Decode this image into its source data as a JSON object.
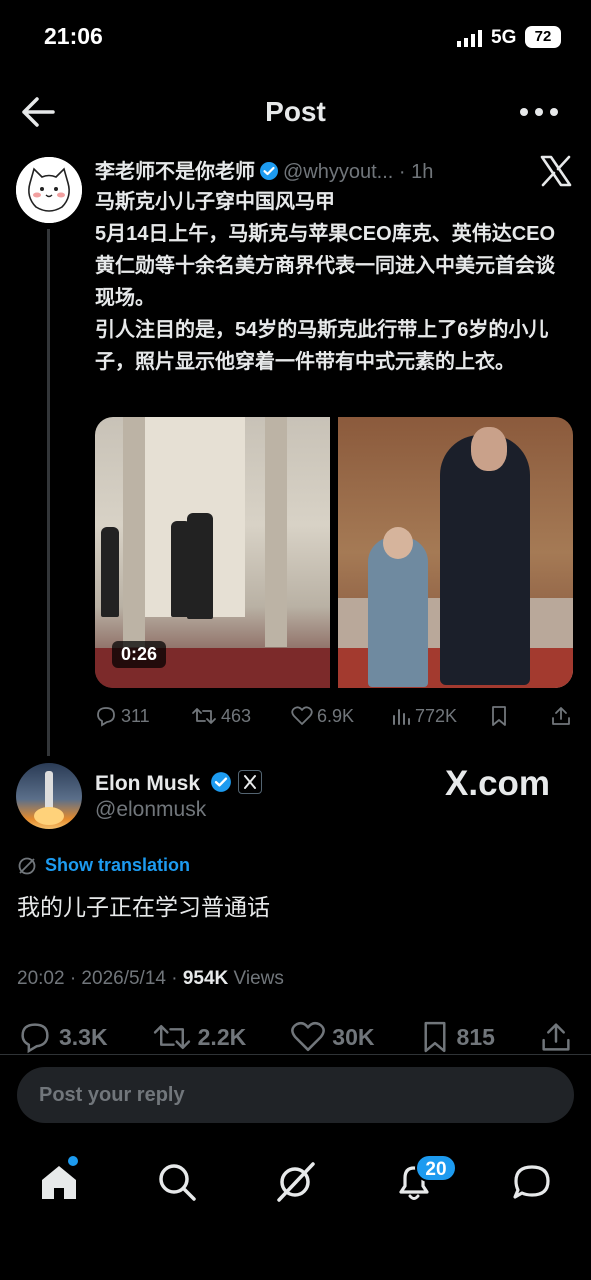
{
  "status_bar": {
    "time": "21:06",
    "network": "5G",
    "battery": "72"
  },
  "header": {
    "title": "Post"
  },
  "quoted_post": {
    "author_name": "李老师不是你老师",
    "handle": "@whyyout...",
    "time": "1h",
    "separator": "·",
    "text_lines": [
      "马斯克小儿子穿中国风马甲",
      "5月14日上午，马斯克与苹果CEO库克、英伟达CEO黄仁勋等十余名美方商界代表一同进入中美元首会谈现场。",
      "引人注目的是，54岁的马斯克此行带上了6岁的小儿子，照片显示他穿着一件带有中式元素的上衣。"
    ],
    "video_duration": "0:26",
    "stats": {
      "replies": "311",
      "reposts": "463",
      "likes": "6.9K",
      "views": "772K"
    }
  },
  "main_post": {
    "author_name": "Elon Musk",
    "handle": "@elonmusk",
    "watermark": "X.com",
    "translate_label": "Show translation",
    "text": "我的儿子正在学习普通话",
    "timestamp": "20:02 · 2026/5/14 · ",
    "views_count": "954K",
    "views_label": " Views",
    "stats": {
      "replies": "3.3K",
      "reposts": "2.2K",
      "likes": "30K",
      "bookmarks": "815"
    }
  },
  "reply_box": {
    "placeholder": "Post your reply"
  },
  "nav": {
    "notifications_badge": "20"
  },
  "colors": {
    "accent": "#1d9bf0",
    "background": "#000000",
    "secondary_text": "#71767b"
  }
}
